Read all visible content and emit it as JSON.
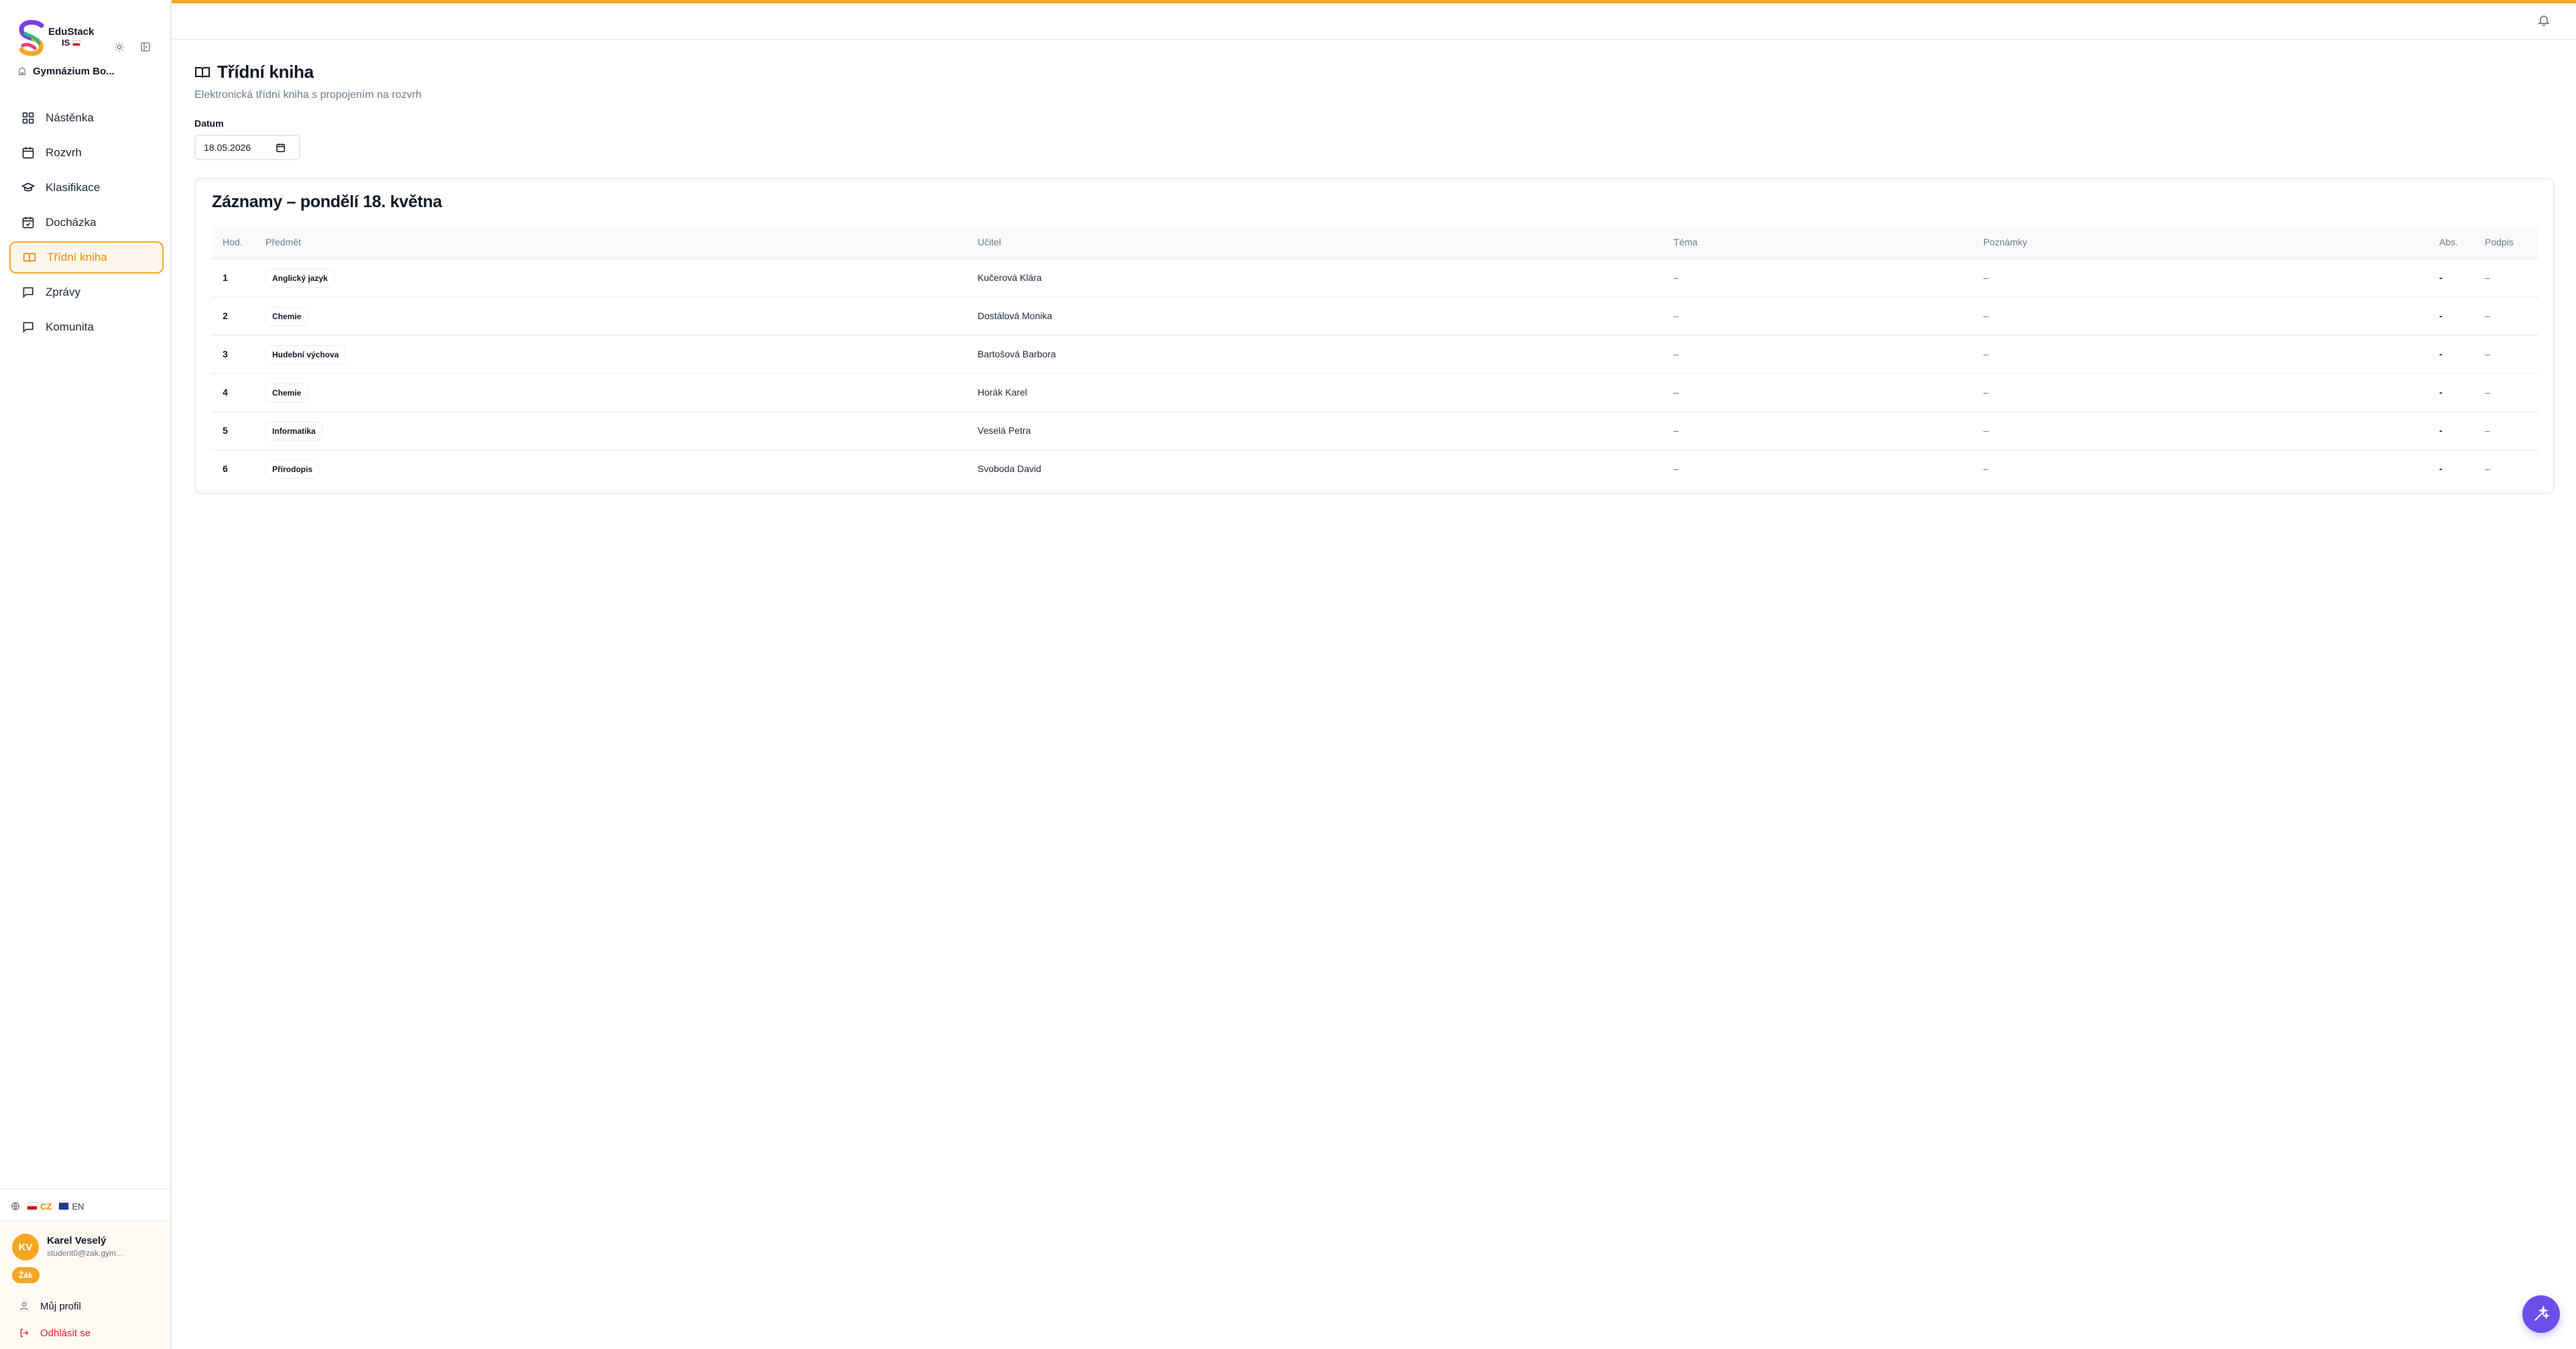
{
  "app": {
    "name": "EduStack",
    "suffix": "IS",
    "school": "Gymnázium Bo..."
  },
  "sidebar": {
    "items": [
      {
        "label": "Nástěnka",
        "icon": "dashboard-icon",
        "active": false
      },
      {
        "label": "Rozvrh",
        "icon": "calendar-icon",
        "active": false
      },
      {
        "label": "Klasifikace",
        "icon": "graduation-cap-icon",
        "active": false
      },
      {
        "label": "Docházka",
        "icon": "calendar-check-icon",
        "active": false
      },
      {
        "label": "Třídní kniha",
        "icon": "book-open-icon",
        "active": true
      },
      {
        "label": "Zprávy",
        "icon": "message-icon",
        "active": false
      },
      {
        "label": "Komunita",
        "icon": "message-square-icon",
        "active": false
      }
    ],
    "languages": [
      {
        "code": "CZ",
        "active": true
      },
      {
        "code": "EN",
        "active": false
      }
    ]
  },
  "user": {
    "initials": "KV",
    "name": "Karel Veselý",
    "email": "student0@zak.gym...",
    "role": "Žák",
    "profile_label": "Můj profil",
    "logout_label": "Odhlásit se"
  },
  "page": {
    "title": "Třídní kniha",
    "subtitle": "Elektronická třídní kniha s propojením na rozvrh",
    "date_label": "Datum",
    "date_value": "18.05.2026"
  },
  "records": {
    "title": "Záznamy – pondělí 18. května",
    "columns": [
      "Hod.",
      "Předmět",
      "Učitel",
      "Téma",
      "Poznámky",
      "Abs.",
      "Podpis"
    ],
    "rows": [
      {
        "hour": "1",
        "subject": "Anglický jazyk",
        "teacher": "Kučerová Klára",
        "topic": "–",
        "notes": "–",
        "abs": "-",
        "sign": "–"
      },
      {
        "hour": "2",
        "subject": "Chemie",
        "teacher": "Dostálová Monika",
        "topic": "–",
        "notes": "–",
        "abs": "-",
        "sign": "–"
      },
      {
        "hour": "3",
        "subject": "Hudební výchova",
        "teacher": "Bartošová Barbora",
        "topic": "–",
        "notes": "–",
        "abs": "-",
        "sign": "–"
      },
      {
        "hour": "4",
        "subject": "Chemie",
        "teacher": "Horák Karel",
        "topic": "–",
        "notes": "–",
        "abs": "-",
        "sign": "–"
      },
      {
        "hour": "5",
        "subject": "Informatika",
        "teacher": "Veselá Petra",
        "topic": "–",
        "notes": "–",
        "abs": "-",
        "sign": "–"
      },
      {
        "hour": "6",
        "subject": "Přírodopis",
        "teacher": "Svoboda David",
        "topic": "–",
        "notes": "–",
        "abs": "-",
        "sign": "–"
      }
    ]
  },
  "colors": {
    "accent": "#f5a623",
    "accent_text": "#ea8a0c",
    "fab": "#6d4ee8",
    "logout": "#dc2626"
  }
}
